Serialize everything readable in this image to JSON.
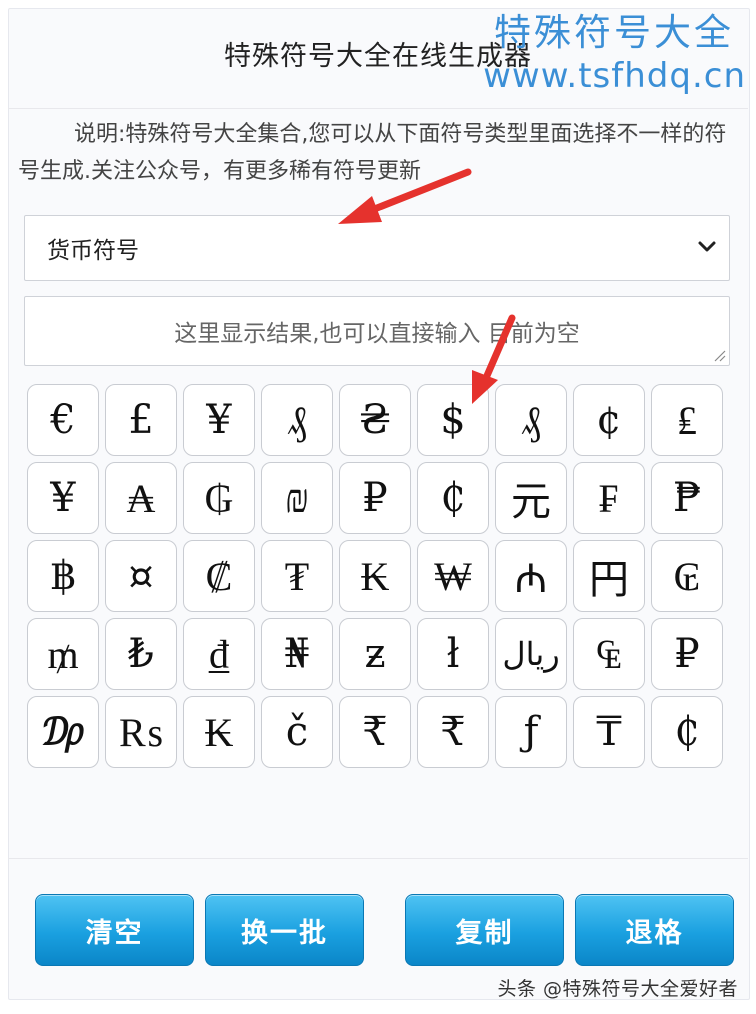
{
  "header": {
    "title": "特殊符号大全在线生成器",
    "watermark_cn": "特殊符号大全",
    "watermark_url": "www.tsfhdq.cn"
  },
  "description": "说明:特殊符号大全集合,您可以从下面符号类型里面选择不一样的符号生成.关注公众号，有更多稀有符号更新",
  "category_select": {
    "selected": "货币符号",
    "icon": "chevron-down-icon"
  },
  "result": {
    "placeholder": "这里显示结果,也可以直接输入 目前为空"
  },
  "symbols": [
    "€",
    "£",
    "¥",
    "₰",
    "₴",
    "$",
    "₰",
    "¢",
    "₤",
    "¥",
    "₳",
    "₲",
    "₪",
    "₽",
    "₵",
    "元",
    "₣",
    "₱",
    "฿",
    "¤",
    "₡",
    "₮",
    "₭",
    "₩",
    "₼",
    "円",
    "₢",
    "₥",
    "₺",
    "₫",
    "₦",
    "ƶ",
    "ł",
    "ریال",
    "₠",
    "₽",
    "₯",
    "₨",
    "₭",
    "č",
    "₹",
    "₹",
    "ƒ",
    "₸",
    "₵"
  ],
  "buttons": {
    "clear": "清空",
    "refresh": "换一批",
    "copy": "复制",
    "backspace": "退格"
  },
  "footer": {
    "credit": "头条 @特殊符号大全爱好者"
  },
  "colors": {
    "accent": "#1aa0e0",
    "watermark": "#3b8fd6",
    "arrow": "#e5322d"
  }
}
